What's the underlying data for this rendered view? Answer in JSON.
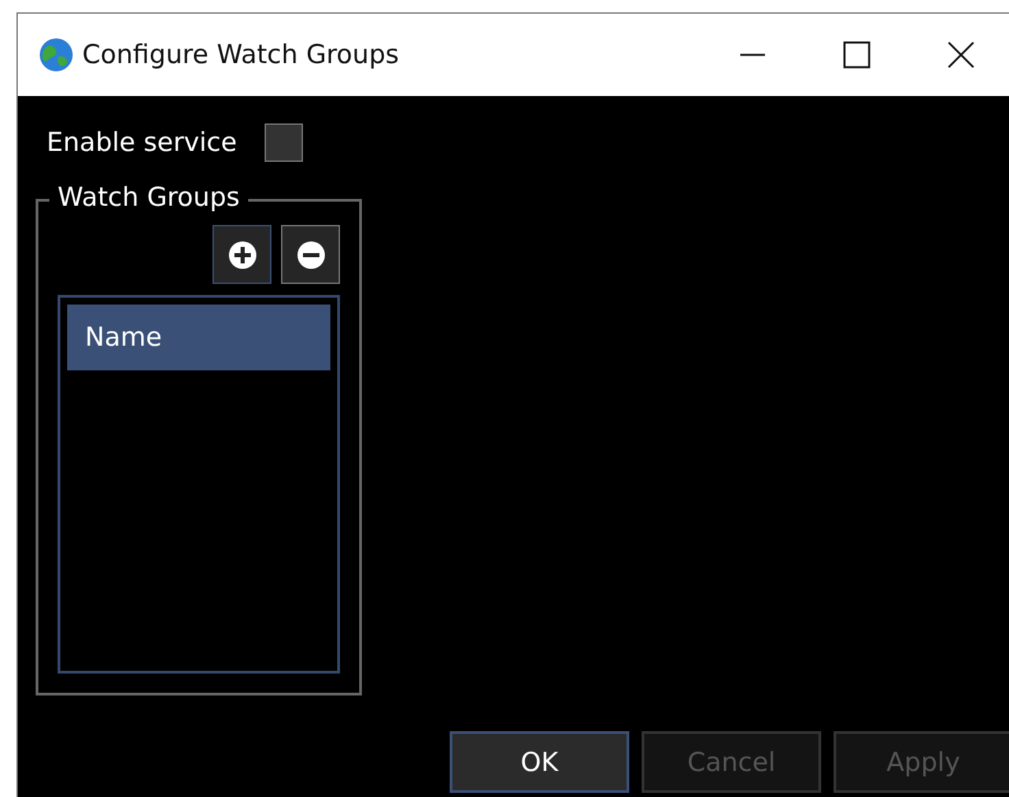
{
  "window": {
    "title": "Configure Watch Groups"
  },
  "enable_service": {
    "label": "Enable service",
    "checked": false
  },
  "watch_groups": {
    "title": "Watch Groups",
    "list": {
      "columns": [
        "Name"
      ]
    }
  },
  "buttons": [
    {
      "label": "OK",
      "disabled": false,
      "default": true
    },
    {
      "label": "Cancel",
      "disabled": true,
      "default": false
    },
    {
      "label": "Apply",
      "disabled": true,
      "default": false
    }
  ]
}
